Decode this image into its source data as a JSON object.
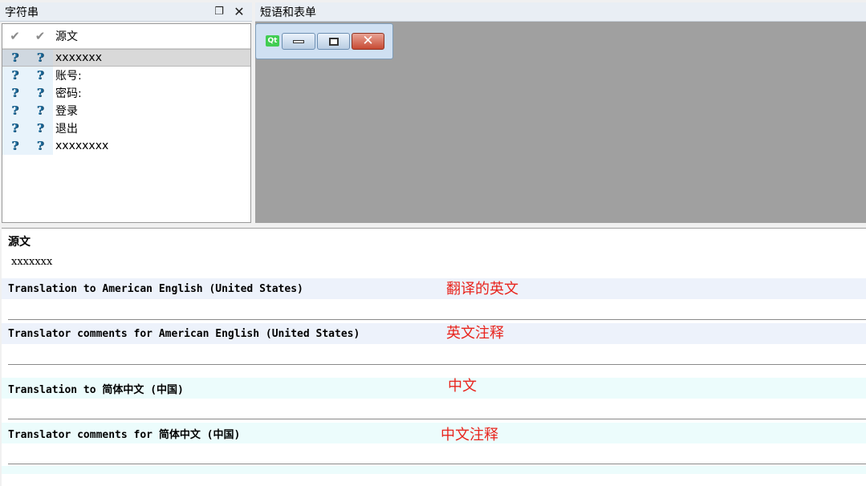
{
  "strings_dock": {
    "title": "字符串",
    "float_icon": "float-icon",
    "close_icon": "close-icon",
    "header": {
      "check1": "✔",
      "check2": "✔",
      "source_col": "源文"
    },
    "rows": [
      {
        "text": "xxxxxxx",
        "selected": true
      },
      {
        "text": "账号:",
        "selected": false
      },
      {
        "text": "密码:",
        "selected": false
      },
      {
        "text": "登录",
        "selected": false
      },
      {
        "text": "退出",
        "selected": false
      },
      {
        "text": "xxxxxxxx",
        "selected": false
      }
    ],
    "status_glyph": "?"
  },
  "phrase_dock": {
    "title": "短语和表单",
    "qt_logo": "Qt"
  },
  "editor": {
    "source_label": "源文",
    "source_text": "xxxxxxx",
    "sections": [
      {
        "label": "Translation to American English (United States)",
        "annotation": "翻译的英文",
        "value": ""
      },
      {
        "label": "Translator comments for American English (United States)",
        "annotation": "英文注释",
        "value": ""
      },
      {
        "label": "Translation to 简体中文 (中国)",
        "annotation": "中文",
        "value": ""
      },
      {
        "label": "Translator comments for 简体中文 (中国)",
        "annotation": "中文注释",
        "value": ""
      }
    ]
  },
  "colors": {
    "annotation": "#e8241c",
    "english_bg": "#edf2fb",
    "chinese_bg": "#ecfcfc"
  }
}
